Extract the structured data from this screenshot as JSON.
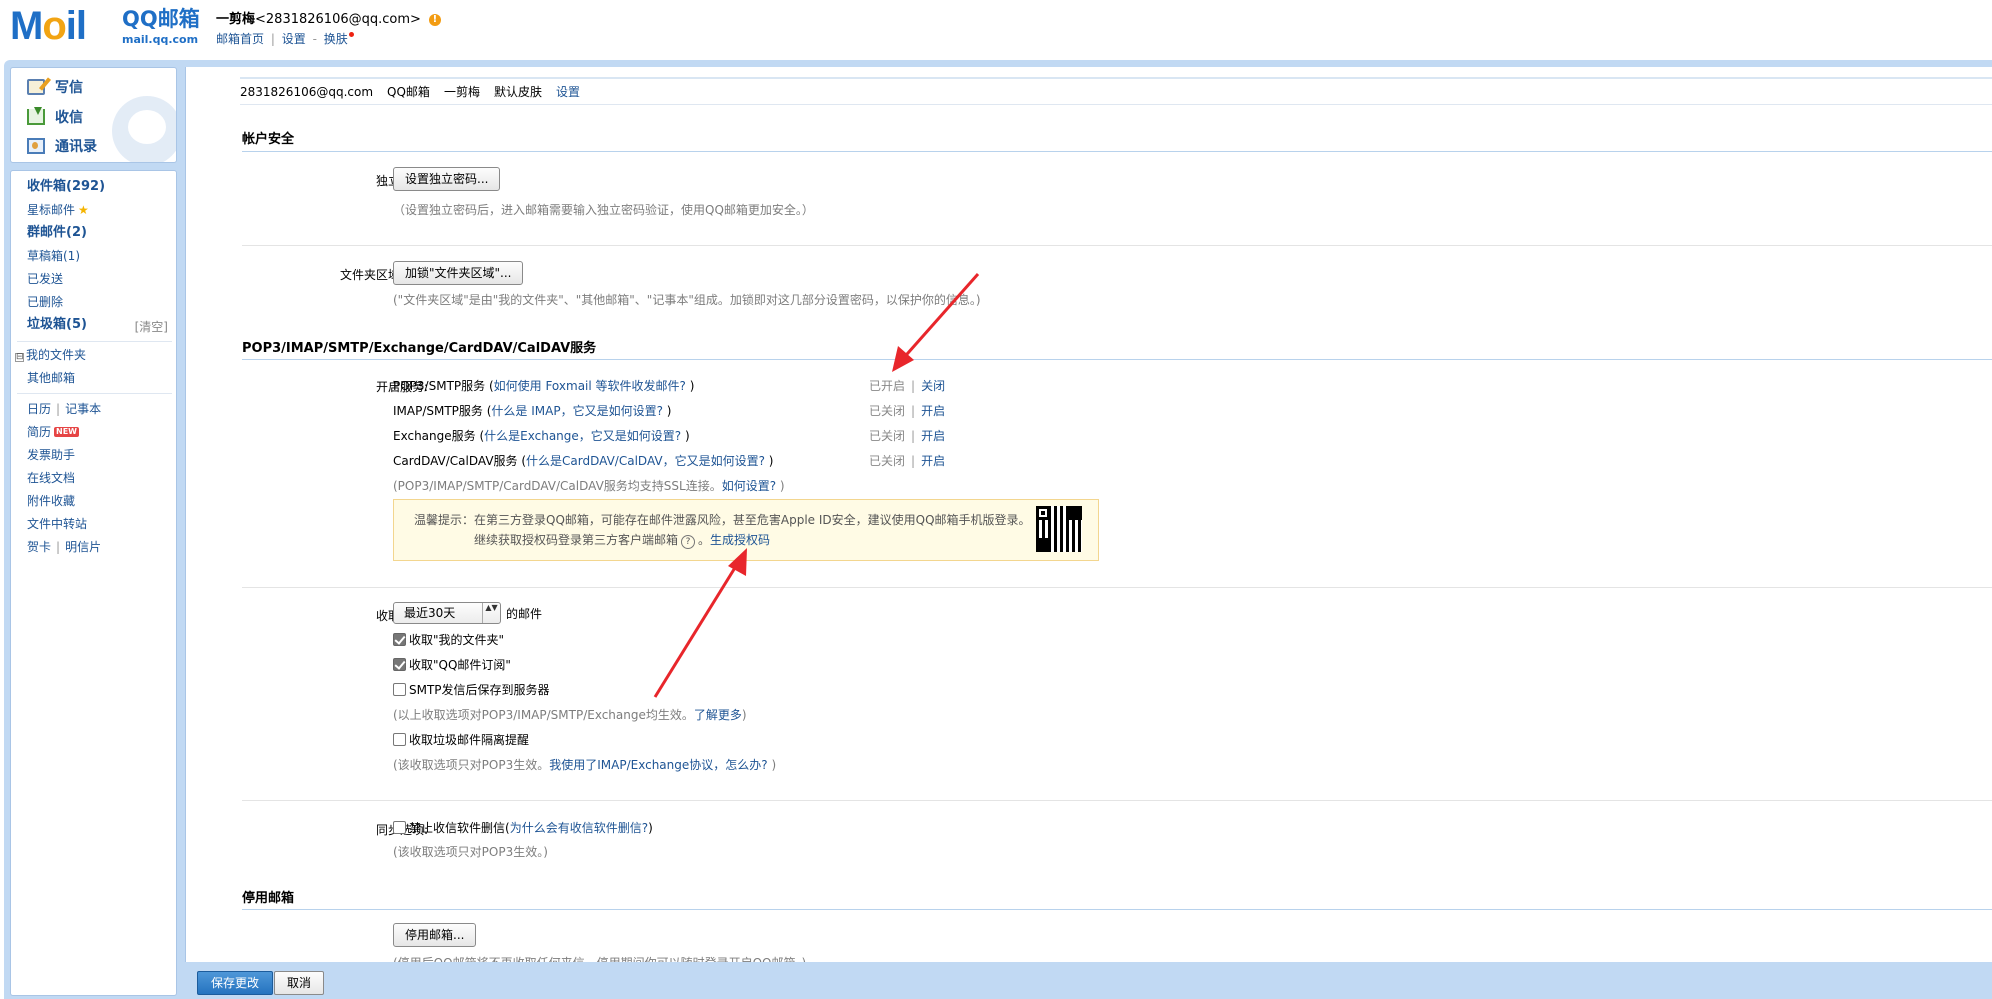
{
  "header": {
    "logo_main": "Mail",
    "logo_qq": "QQ邮箱",
    "logo_domain": "mail.qq.com",
    "user_name": "一剪梅",
    "user_email": "<2831826106@qq.com>",
    "warn_glyph": "!",
    "links": [
      "邮箱首页",
      "设置",
      "换肤"
    ],
    "sep_pipe": "|",
    "sep_dash": "-"
  },
  "nav": {
    "write": "写信",
    "receive": "收信",
    "contacts": "通讯录",
    "inbox": "收件箱(292)",
    "starred": "星标邮件",
    "star_glyph": "★",
    "group": "群邮件(2)",
    "drafts": "草稿箱(1)",
    "sent": "已发送",
    "deleted": "已删除",
    "spam": "垃圾箱(5)",
    "spam_clear": "[清空]",
    "folder_toggle": "⊟",
    "my_folders": "我的文件夹",
    "other_mail": "其他邮箱",
    "calendar": "日历",
    "notes": "记事本",
    "resume": "简历",
    "new_badge": "NEW",
    "invoice": "发票助手",
    "docs": "在线文档",
    "attachments": "附件收藏",
    "transfer": "文件中转站",
    "card": "贺卡",
    "postcard": "明信片",
    "pipe": "|"
  },
  "breadcrumb": [
    "2831826106@qq.com",
    "QQ邮箱",
    "一剪梅",
    "默认皮肤",
    "设置"
  ],
  "account_security": {
    "title": "帐户安全",
    "pwd_label": "独立密码:",
    "pwd_button": "设置独立密码...",
    "pwd_tip": "（设置独立密码后，进入邮箱需要输入独立密码验证，使用QQ邮箱更加安全。）",
    "lock_label": "文件夹区域加锁:",
    "lock_button": "加锁\"文件夹区域\"...",
    "lock_tip": "(\"文件夹区域\"是由\"我的文件夹\"、\"其他邮箱\"、\"记事本\"组成。加锁即对这几部分设置密码，以保护你的信息。)"
  },
  "services": {
    "title": "POP3/IMAP/SMTP/Exchange/CardDAV/CalDAV服务",
    "label": "开启服务:",
    "rows": [
      {
        "name": "POP3/SMTP服务",
        "help": "如何使用 Foxmail 等软件收发邮件?",
        "status": "已开启",
        "action": "关闭"
      },
      {
        "name": "IMAP/SMTP服务",
        "help": "什么是 IMAP，它又是如何设置?",
        "status": "已关闭",
        "action": "开启"
      },
      {
        "name": "Exchange服务",
        "help": "什么是Exchange，它又是如何设置?",
        "status": "已关闭",
        "action": "开启"
      },
      {
        "name": "CardDAV/CalDAV服务",
        "help": "什么是CardDAV/CalDAV，它又是如何设置?",
        "status": "已关闭",
        "action": "开启"
      }
    ],
    "open_paren": " (",
    "close_paren": " )",
    "status_sep": "|",
    "ssl_tip_prefix": "(POP3/IMAP/SMTP/CardDAV/CalDAV服务均支持SSL连接。",
    "ssl_tip_link": "如何设置?",
    "ssl_tip_suffix": " )",
    "warning_line1": "温馨提示：在第三方登录QQ邮箱，可能存在邮件泄露风险，甚至危害Apple ID安全，建议使用QQ邮箱手机版登录。",
    "warning_line2": "继续获取授权码登录第三方客户端邮箱",
    "help_glyph": "?",
    "warning_period": "。",
    "warning_link": "生成授权码"
  },
  "receive_options": {
    "label": "收取选项:",
    "select_value": "最近30天",
    "select_arrows": "▲▼",
    "select_suffix": "的邮件",
    "cb1": "收取\"我的文件夹\"",
    "cb2": "收取\"QQ邮件订阅\"",
    "cb3": "SMTP发信后保存到服务器",
    "tip1_prefix": "(以上收取选项对POP3/IMAP/SMTP/Exchange均生效。",
    "tip1_link": "了解更多",
    "tip1_suffix": ")",
    "cb4": "收取垃圾邮件隔离提醒",
    "tip2_prefix": "(该收取选项只对POP3生效。",
    "tip2_link": "我使用了IMAP/Exchange协议，怎么办?",
    "tip2_suffix": " )"
  },
  "sync_options": {
    "label": "同步选项:",
    "cb": "禁止收信软件删信",
    "help": "为什么会有收信软件删信?",
    "open_paren": " (",
    "close_paren": " )",
    "tip": "(该收取选项只对POP3生效。)"
  },
  "disable_mailbox": {
    "title": "停用邮箱",
    "button": "停用邮箱...",
    "tip_partial": "(停用后QQ邮箱将不再收取任何来信，停用期间你可以随时登录开启QQ邮箱。)"
  },
  "footer": {
    "save": "保存更改",
    "cancel": "取消"
  },
  "colors": {
    "brand_blue": "#1f6fc6",
    "link": "#1e5494",
    "frame": "#c1d9f3",
    "annotation_arrow": "#e8262b"
  }
}
